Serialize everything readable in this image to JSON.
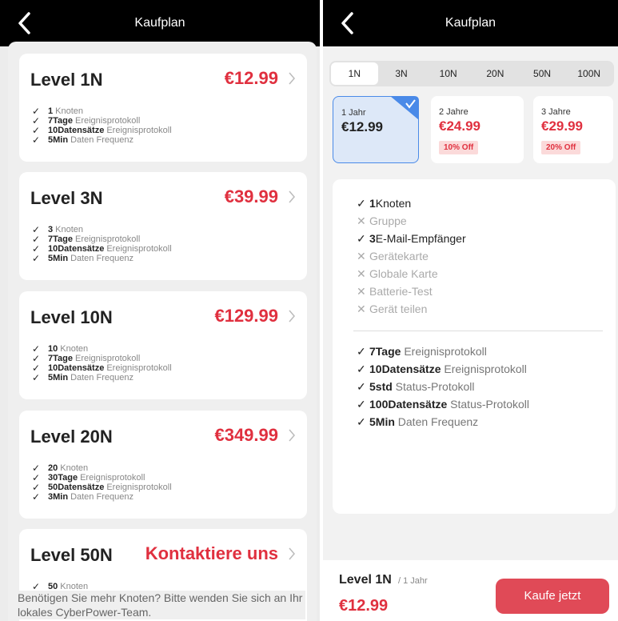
{
  "left": {
    "title": "Kaufplan",
    "plans": [
      {
        "name": "Level 1N",
        "price": "€12.99",
        "features": [
          {
            "bold": "1",
            "text": "Knoten"
          },
          {
            "bold": "7Tage",
            "text": "Ereignisprotokoll"
          },
          {
            "bold": "10Datensätze",
            "text": "Ereignisprotokoll"
          },
          {
            "bold": "5Min",
            "text": "Daten Frequenz"
          }
        ]
      },
      {
        "name": "Level 3N",
        "price": "€39.99",
        "features": [
          {
            "bold": "3",
            "text": "Knoten"
          },
          {
            "bold": "7Tage",
            "text": "Ereignisprotokoll"
          },
          {
            "bold": "10Datensätze",
            "text": "Ereignisprotokoll"
          },
          {
            "bold": "5Min",
            "text": "Daten Frequenz"
          }
        ]
      },
      {
        "name": "Level 10N",
        "price": "€129.99",
        "features": [
          {
            "bold": "10",
            "text": "Knoten"
          },
          {
            "bold": "7Tage",
            "text": "Ereignisprotokoll"
          },
          {
            "bold": "10Datensätze",
            "text": "Ereignisprotokoll"
          },
          {
            "bold": "5Min",
            "text": "Daten Frequenz"
          }
        ]
      },
      {
        "name": "Level 20N",
        "price": "€349.99",
        "features": [
          {
            "bold": "20",
            "text": "Knoten"
          },
          {
            "bold": "30Tage",
            "text": "Ereignisprotokoll"
          },
          {
            "bold": "50Datensätze",
            "text": "Ereignisprotokoll"
          },
          {
            "bold": "3Min",
            "text": "Daten Frequenz"
          }
        ]
      },
      {
        "name": "Level 50N",
        "price": "Kontaktiere uns",
        "features": [
          {
            "bold": "50",
            "text": "Knoten"
          }
        ]
      }
    ],
    "footer": "Benötigen Sie mehr Knoten? Bitte wenden Sie sich an Ihr lokales CyberPower-Team."
  },
  "right": {
    "title": "Kaufplan",
    "tabs": [
      "1N",
      "3N",
      "10N",
      "20N",
      "50N",
      "100N"
    ],
    "active_tab": "1N",
    "periods": [
      {
        "label": "1 Jahr",
        "price": "€12.99",
        "discount": ""
      },
      {
        "label": "2 Jahre",
        "price": "€24.99",
        "discount": "10% Off"
      },
      {
        "label": "3 Jahre",
        "price": "€29.99",
        "discount": "20% Off"
      }
    ],
    "features": [
      {
        "bold": "1",
        "text": "Knoten",
        "included": true
      },
      {
        "bold": "",
        "text": "Gruppe",
        "included": false
      },
      {
        "bold": "3",
        "text": "E-Mail-Empfänger",
        "included": true
      },
      {
        "bold": "",
        "text": "Gerätekarte",
        "included": false
      },
      {
        "bold": "",
        "text": "Globale Karte",
        "included": false
      },
      {
        "bold": "",
        "text": "Batterie-Test",
        "included": false
      },
      {
        "bold": "",
        "text": "Gerät teilen",
        "included": false
      }
    ],
    "logs": [
      {
        "bold": "7Tage",
        "text": "Ereignisprotokoll"
      },
      {
        "bold": "10Datensätze",
        "text": "Ereignisprotokoll"
      },
      {
        "bold": "5std",
        "text": "Status-Protokoll"
      },
      {
        "bold": "100Datensätze",
        "text": "Status-Protokoll"
      },
      {
        "bold": "5Min",
        "text": "Daten Frequenz"
      }
    ],
    "summary": {
      "level": "Level 1N",
      "period": "/ 1 Jahr",
      "price": "€12.99"
    },
    "buy_label": "Kaufe jetzt"
  },
  "colors": {
    "accent": "#e0303f",
    "button": "#e04a57",
    "selected_border": "#4a8ae8"
  }
}
